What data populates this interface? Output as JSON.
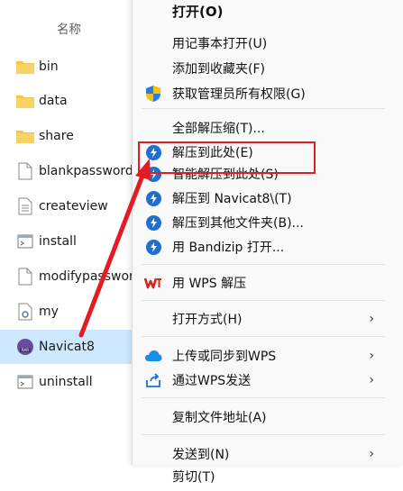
{
  "explorer": {
    "column_header": "名称",
    "files": [
      {
        "name": "bin",
        "icon": "folder-icon"
      },
      {
        "name": "data",
        "icon": "folder-icon"
      },
      {
        "name": "share",
        "icon": "folder-icon"
      },
      {
        "name": "blankpassword",
        "icon": "file-icon"
      },
      {
        "name": "createview",
        "icon": "text-file-icon"
      },
      {
        "name": "install",
        "icon": "script-file-icon"
      },
      {
        "name": "modifypassword",
        "icon": "file-icon"
      },
      {
        "name": "my",
        "icon": "config-file-icon"
      },
      {
        "name": "Navicat8",
        "icon": "rar-archive-icon",
        "selected": true
      },
      {
        "name": "uninstall",
        "icon": "script-file-icon"
      }
    ]
  },
  "context_menu": {
    "items": [
      {
        "label": "打开(O)",
        "bold": true
      },
      {
        "label": "用记事本打开(U)"
      },
      {
        "label": "添加到收藏夹(F)"
      },
      {
        "label": "获取管理员所有权限(G)",
        "icon": "shield-icon"
      },
      {
        "label": "全部解压缩(T)..."
      },
      {
        "label": "解压到此处(E)",
        "icon": "bandizip-icon"
      },
      {
        "label": "智能解压到此处(S)",
        "icon": "bandizip-icon"
      },
      {
        "label": "解压到 Navicat8\\(T)",
        "icon": "bandizip-icon"
      },
      {
        "label": "解压到其他文件夹(B)...",
        "icon": "bandizip-icon"
      },
      {
        "label": "用 Bandizip 打开...",
        "icon": "bandizip-icon"
      },
      {
        "label": "用 WPS 解压",
        "icon": "wps-icon"
      },
      {
        "label": "打开方式(H)",
        "submenu": true
      },
      {
        "label": "上传或同步到WPS",
        "icon": "cloud-icon",
        "submenu": true
      },
      {
        "label": "通过WPS发送",
        "icon": "share-icon",
        "submenu": true
      },
      {
        "label": "复制文件地址(A)"
      },
      {
        "label": "发送到(N)",
        "submenu": true
      },
      {
        "label": "剪切(T)"
      }
    ],
    "submenu_arrow": "›"
  },
  "colors": {
    "selection": "#cde8ff",
    "annotation_red": "#e51b24",
    "bandizip_blue": "#1f6fd1",
    "folder_yellow": "#f4c542",
    "wps_red": "#d7261e"
  }
}
